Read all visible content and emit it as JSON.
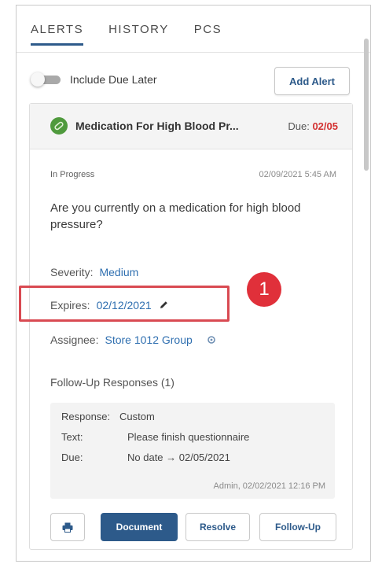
{
  "tabs": [
    {
      "label": "ALERTS",
      "active": true
    },
    {
      "label": "HISTORY",
      "active": false
    },
    {
      "label": "PCS",
      "active": false
    }
  ],
  "toolbar": {
    "toggle_label": "Include Due Later",
    "toggle_on": false,
    "add_alert_label": "Add Alert"
  },
  "alert": {
    "title": "Medication For High Blood Pr...",
    "due_label": "Due:",
    "due_date": "02/05",
    "status": "In Progress",
    "created": "02/09/2021 5:45 AM",
    "question": "Are you currently on a medication for high blood pressure?",
    "severity_label": "Severity:",
    "severity_value": "Medium",
    "expires_label": "Expires:",
    "expires_value": "02/12/2021",
    "assignee_label": "Assignee:",
    "assignee_value": "Store 1012 Group",
    "followup_title": "Follow-Up Responses (1)",
    "response": {
      "response_label": "Response:",
      "response_value": "Custom",
      "text_label": "Text:",
      "text_value": "Please finish questionnaire",
      "due_label": "Due:",
      "due_value": "No date → 02/05/2021",
      "footer": "Admin, 02/02/2021 12:16 PM"
    }
  },
  "callout": {
    "number": "1"
  },
  "actions": {
    "document_label": "Document",
    "resolve_label": "Resolve",
    "followup_label": "Follow-Up"
  },
  "colors": {
    "accent": "#2d5a8a",
    "link": "#2f6fb0",
    "due_red": "#d33030",
    "highlight_red": "#d94a52",
    "icon_green": "#4f9a3d"
  }
}
